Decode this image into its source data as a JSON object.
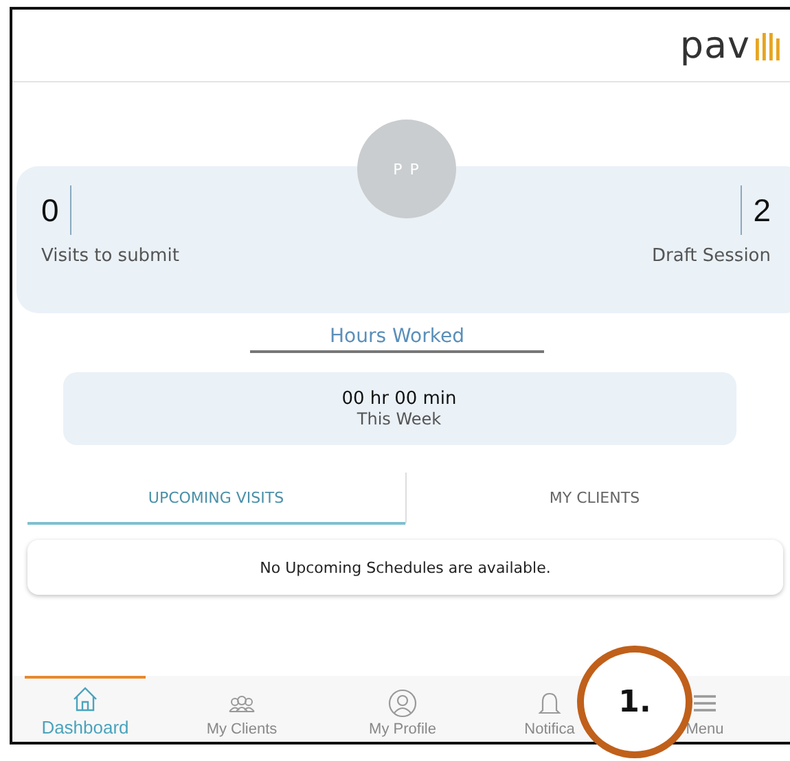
{
  "header": {
    "logo": "pav"
  },
  "profile": {
    "initials": "P P"
  },
  "stats": [
    {
      "value": "0",
      "label": "Visits to submit"
    },
    {
      "value": "2",
      "label": "Draft Session"
    }
  ],
  "hours": {
    "title": "Hours Worked",
    "value": "00 hr 00 min",
    "period": "This Week"
  },
  "tabs": [
    {
      "label": "UPCOMING VISITS",
      "selected": true
    },
    {
      "label": "MY CLIENTS",
      "selected": false
    }
  ],
  "empty_message": "No Upcoming Schedules are available.",
  "nav": [
    {
      "label": "Dashboard",
      "kind": "home",
      "selected": true
    },
    {
      "label": "My Clients",
      "kind": "people",
      "selected": false
    },
    {
      "label": "My Profile",
      "kind": "profile",
      "selected": false
    },
    {
      "label": "Notifica",
      "kind": "bell",
      "selected": false
    },
    {
      "label": "Menu",
      "kind": "menu",
      "selected": false
    }
  ],
  "callout": {
    "label": "1."
  }
}
